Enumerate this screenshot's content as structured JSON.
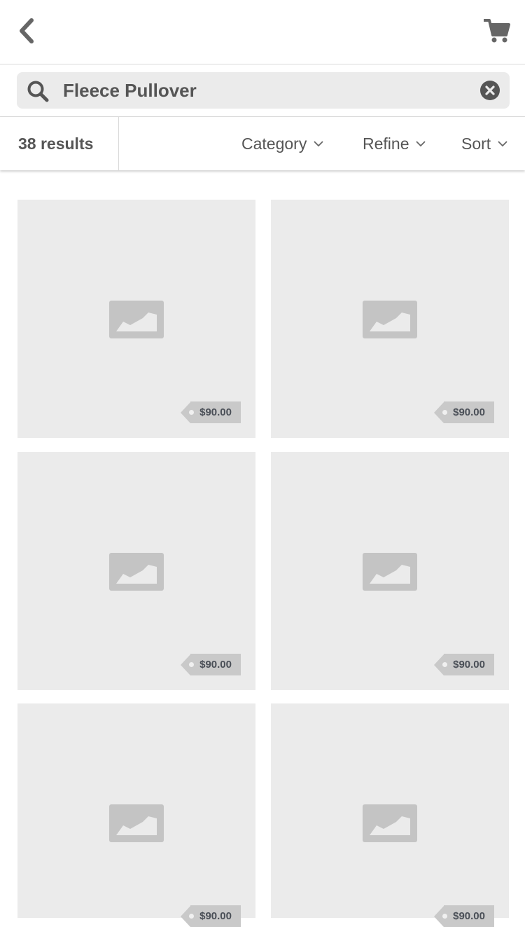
{
  "header": {
    "back_icon": "chevron-left-icon",
    "cart_icon": "shopping-cart-icon"
  },
  "search": {
    "value": "Fleece Pullover",
    "search_icon": "search-icon",
    "clear_icon": "clear-circle-icon"
  },
  "filters": {
    "results_count": "38 results",
    "category_label": "Category",
    "refine_label": "Refine",
    "sort_label": "Sort"
  },
  "products": [
    {
      "price": "$90.00"
    },
    {
      "price": "$90.00"
    },
    {
      "price": "$90.00"
    },
    {
      "price": "$90.00"
    },
    {
      "price": "$90.00"
    },
    {
      "price": "$90.00"
    }
  ],
  "colors": {
    "placeholder_bg": "#ebebeb",
    "icon_gray": "#c4c4c4",
    "text": "#555555"
  }
}
